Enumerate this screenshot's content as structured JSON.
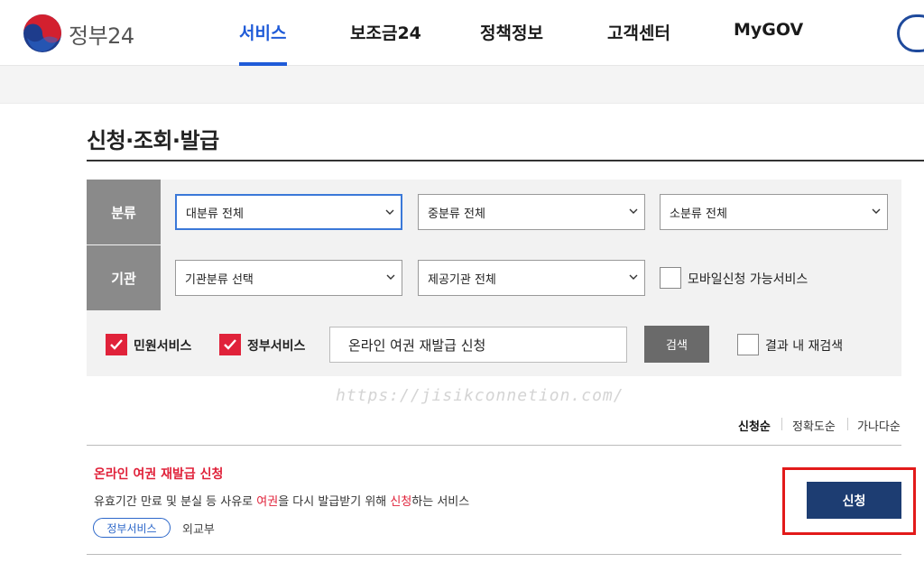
{
  "header": {
    "logo_text": "정부24",
    "nav": [
      {
        "label": "서비스",
        "active": true
      },
      {
        "label": "보조금24",
        "active": false
      },
      {
        "label": "정책정보",
        "active": false
      },
      {
        "label": "고객센터",
        "active": false
      },
      {
        "label": "MyGOV",
        "active": false
      }
    ]
  },
  "page": {
    "title": "신청·조회·발급"
  },
  "filter": {
    "category_label": "분류",
    "agency_label": "기관",
    "selects": {
      "major": "대분류 전체",
      "middle": "중분류 전체",
      "minor": "소분류 전체",
      "agency_type": "기관분류 선택",
      "provider": "제공기관 전체"
    },
    "mobile_label": "모바일신청 가능서비스",
    "mobile_checked": false,
    "civil_label": "민원서비스",
    "civil_checked": true,
    "gov_label": "정부서비스",
    "gov_checked": true,
    "search_value": "온라인 여권 재발급 신청",
    "search_button": "검색",
    "research_label": "결과 내 재검색",
    "research_checked": false
  },
  "watermark": "https://jisikconnetion.com/",
  "sort": {
    "options": [
      "신청순",
      "정확도순",
      "가나다순"
    ],
    "selected": "신청순"
  },
  "result": {
    "title": "온라인 여권 재발급 신청",
    "desc_parts": [
      "유효기간 만료 및 분실 등 사유로 ",
      "여권",
      "을 다시 발급받기 위해 ",
      "신청",
      "하는 서비스"
    ],
    "tag": "정부서비스",
    "agency": "외교부",
    "apply_label": "신청"
  },
  "colors": {
    "accent_blue": "#1f5bd8",
    "highlight_red": "#e0223a",
    "apply_navy": "#1d3d72"
  }
}
